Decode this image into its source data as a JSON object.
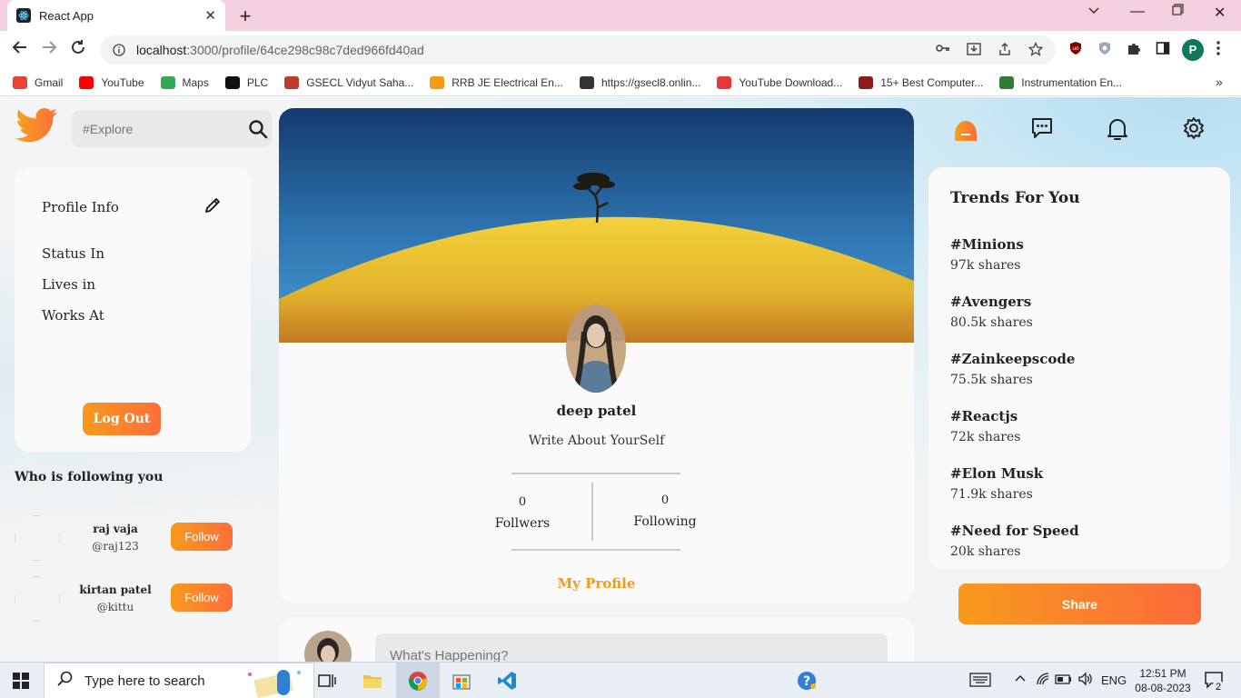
{
  "browser": {
    "tab_title": "React App",
    "url_host": "localhost",
    "url_path": ":3000/profile/64ce298c98c7ded966fd40ad",
    "profile_initial": "P",
    "bookmarks": [
      {
        "label": "Gmail",
        "color": "#ea4335"
      },
      {
        "label": "YouTube",
        "color": "#ff0000"
      },
      {
        "label": "Maps",
        "color": "#34a853"
      },
      {
        "label": "PLC",
        "color": "#111111"
      },
      {
        "label": "GSECL Vidyut Saha...",
        "color": "#c0392b"
      },
      {
        "label": "RRB JE Electrical En...",
        "color": "#f39c12"
      },
      {
        "label": "https://gsecl8.onlin...",
        "color": "#333333"
      },
      {
        "label": "YouTube Download...",
        "color": "#e53935"
      },
      {
        "label": "15+ Best Computer...",
        "color": "#8e1b1b"
      },
      {
        "label": "Instrumentation En...",
        "color": "#2e7d32"
      }
    ]
  },
  "app": {
    "search_placeholder": "#Explore",
    "profile_card": {
      "title": "Profile Info",
      "rows": [
        "Status In",
        "Lives in",
        "Works At"
      ],
      "logout_label": "Log Out"
    },
    "followers_heading": "Who is following you",
    "followers": [
      {
        "name": "raj vaja",
        "handle": "@raj123",
        "button": "Follow"
      },
      {
        "name": "kirtan patel",
        "handle": "@kittu",
        "button": "Follow"
      }
    ],
    "profile": {
      "name": "deep patel",
      "bio": "Write About YourSelf",
      "followers_count": "0",
      "followers_label": "Follwers",
      "following_count": "0",
      "following_label": "Following",
      "my_profile_link": "My Profile"
    },
    "post": {
      "placeholder": "What's Happening?"
    },
    "trends": {
      "heading": "Trends For You",
      "items": [
        {
          "name": "#Minions",
          "shares": "97k shares"
        },
        {
          "name": "#Avengers",
          "shares": "80.5k shares"
        },
        {
          "name": "#Zainkeepscode",
          "shares": "75.5k shares"
        },
        {
          "name": "#Reactjs",
          "shares": "72k shares"
        },
        {
          "name": "#Elon Musk",
          "shares": "71.9k shares"
        },
        {
          "name": "#Need for Speed",
          "shares": "20k shares"
        }
      ]
    },
    "share_label": "Share",
    "accent": "#f79a1c"
  },
  "taskbar": {
    "search_text": "Type here to search",
    "language": "ENG",
    "time": "12:51 PM",
    "date": "08-08-2023",
    "notification_count": "2"
  }
}
